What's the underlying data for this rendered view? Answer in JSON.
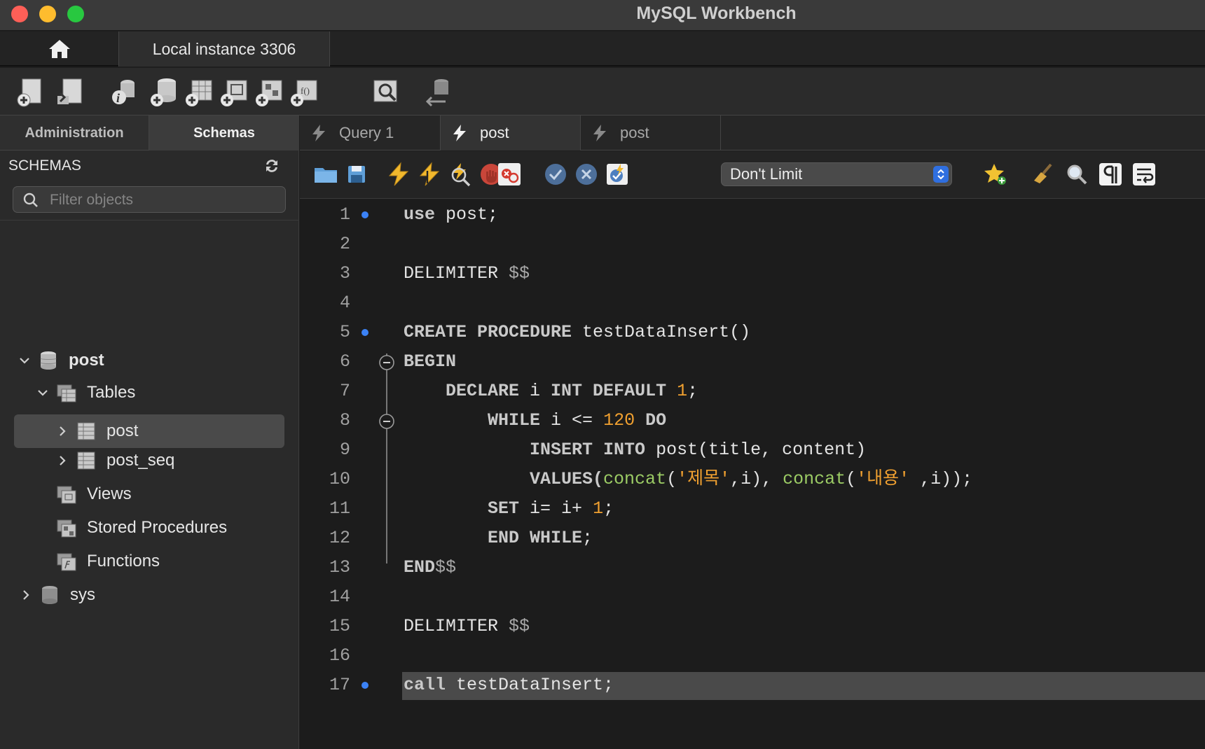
{
  "window": {
    "title": "MySQL Workbench"
  },
  "connection_tabs": {
    "instance_label": "Local instance 3306"
  },
  "sidebar": {
    "tabs": [
      "Administration",
      "Schemas"
    ],
    "header": "SCHEMAS",
    "filter_placeholder": "Filter objects",
    "tree": {
      "schema_post": "post",
      "tables": "Tables",
      "table_post": "post",
      "table_post_seq": "post_seq",
      "views": "Views",
      "stored_procedures": "Stored Procedures",
      "functions": "Functions",
      "schema_sys": "sys"
    }
  },
  "query_tabs": [
    "Query 1",
    "post",
    "post"
  ],
  "editor_toolbar": {
    "limit_value": "Don't Limit"
  },
  "editor": {
    "line_numbers": [
      "1",
      "2",
      "3",
      "4",
      "5",
      "6",
      "7",
      "8",
      "9",
      "10",
      "11",
      "12",
      "13",
      "14",
      "15",
      "16",
      "17"
    ],
    "tokens": {
      "l1a": "use",
      "l1b": " post;",
      "l3a": "DELIMITER",
      "l3b": " $$",
      "l5a": "CREATE PROCEDURE",
      "l5b": " testDataInsert()",
      "l6a": "BEGIN",
      "l7a": "    DECLARE",
      "l7b": " i ",
      "l7c": "INT DEFAULT",
      "l7d": " ",
      "l7e": "1",
      "l7f": ";",
      "l8a": "        WHILE",
      "l8b": " i <= ",
      "l8c": "120",
      "l8d": " ",
      "l8e": "DO",
      "l9a": "            INSERT INTO",
      "l9b": " post(title, content)",
      "l10a": "            VALUES(",
      "l10b": "concat",
      "l10c": "(",
      "l10d": "'제목'",
      "l10e": ",i), ",
      "l10f": "concat",
      "l10g": "(",
      "l10h": "'내용'",
      "l10i": " ,i));",
      "l11a": "        SET",
      "l11b": " i= i+ ",
      "l11c": "1",
      "l11d": ";",
      "l12a": "        END WHILE",
      "l12b": ";",
      "l13a": "END",
      "l13b": "$$",
      "l15a": "DELIMITER",
      "l15b": " $$",
      "l17a": "call",
      "l17b": " testDataInsert;"
    }
  }
}
